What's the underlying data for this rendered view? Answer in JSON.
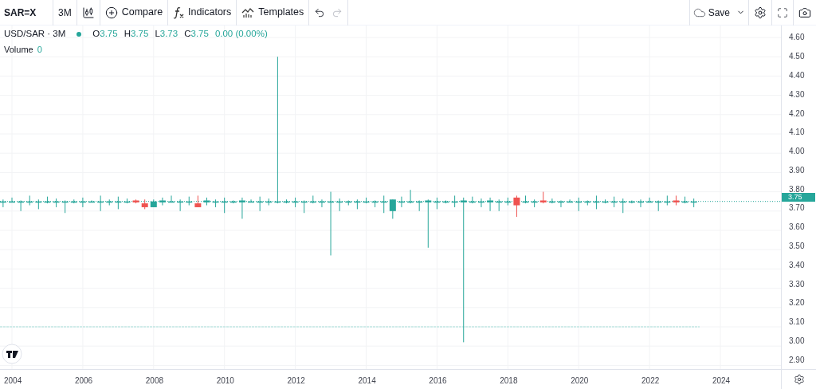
{
  "toolbar": {
    "symbol": "SAR=X",
    "interval": "3M",
    "buttons": [
      {
        "kind": "compare",
        "label": "Compare"
      },
      {
        "kind": "indicators",
        "label": "Indicators"
      },
      {
        "kind": "templates",
        "label": "Templates"
      }
    ],
    "save": "Save"
  },
  "legend": {
    "title": "USD/SAR · 3M",
    "ohlc": [
      {
        "label": "O",
        "value": "3.75"
      },
      {
        "label": "H",
        "value": "3.75"
      },
      {
        "label": "L",
        "value": "3.73"
      },
      {
        "label": "C",
        "value": "3.75"
      }
    ],
    "change": "0.00 (0.00%)",
    "volume_label": "Volume",
    "volume_value": "0"
  },
  "price_axis": {
    "labels": [
      "4.60",
      "4.50",
      "4.40",
      "4.30",
      "4.20",
      "4.10",
      "4.00",
      "3.90",
      "3.80",
      "3.70",
      "3.60",
      "3.50",
      "3.40",
      "3.30",
      "3.20",
      "3.10",
      "3.00",
      "2.90"
    ],
    "current_price": "3.75"
  },
  "time_axis": {
    "labels": [
      "2004",
      "2006",
      "2008",
      "2010",
      "2012",
      "2014",
      "2016",
      "2018",
      "2020",
      "2022",
      "2024"
    ]
  }
}
